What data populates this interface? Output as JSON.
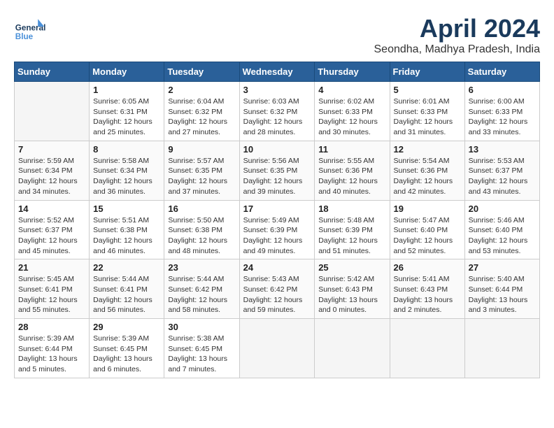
{
  "header": {
    "logo_general": "General",
    "logo_blue": "Blue",
    "title": "April 2024",
    "location": "Seondha, Madhya Pradesh, India"
  },
  "days_of_week": [
    "Sunday",
    "Monday",
    "Tuesday",
    "Wednesday",
    "Thursday",
    "Friday",
    "Saturday"
  ],
  "weeks": [
    [
      {
        "day": "",
        "empty": true
      },
      {
        "day": "1",
        "sunrise": "Sunrise: 6:05 AM",
        "sunset": "Sunset: 6:31 PM",
        "daylight": "Daylight: 12 hours and 25 minutes."
      },
      {
        "day": "2",
        "sunrise": "Sunrise: 6:04 AM",
        "sunset": "Sunset: 6:32 PM",
        "daylight": "Daylight: 12 hours and 27 minutes."
      },
      {
        "day": "3",
        "sunrise": "Sunrise: 6:03 AM",
        "sunset": "Sunset: 6:32 PM",
        "daylight": "Daylight: 12 hours and 28 minutes."
      },
      {
        "day": "4",
        "sunrise": "Sunrise: 6:02 AM",
        "sunset": "Sunset: 6:33 PM",
        "daylight": "Daylight: 12 hours and 30 minutes."
      },
      {
        "day": "5",
        "sunrise": "Sunrise: 6:01 AM",
        "sunset": "Sunset: 6:33 PM",
        "daylight": "Daylight: 12 hours and 31 minutes."
      },
      {
        "day": "6",
        "sunrise": "Sunrise: 6:00 AM",
        "sunset": "Sunset: 6:33 PM",
        "daylight": "Daylight: 12 hours and 33 minutes."
      }
    ],
    [
      {
        "day": "7",
        "sunrise": "Sunrise: 5:59 AM",
        "sunset": "Sunset: 6:34 PM",
        "daylight": "Daylight: 12 hours and 34 minutes."
      },
      {
        "day": "8",
        "sunrise": "Sunrise: 5:58 AM",
        "sunset": "Sunset: 6:34 PM",
        "daylight": "Daylight: 12 hours and 36 minutes."
      },
      {
        "day": "9",
        "sunrise": "Sunrise: 5:57 AM",
        "sunset": "Sunset: 6:35 PM",
        "daylight": "Daylight: 12 hours and 37 minutes."
      },
      {
        "day": "10",
        "sunrise": "Sunrise: 5:56 AM",
        "sunset": "Sunset: 6:35 PM",
        "daylight": "Daylight: 12 hours and 39 minutes."
      },
      {
        "day": "11",
        "sunrise": "Sunrise: 5:55 AM",
        "sunset": "Sunset: 6:36 PM",
        "daylight": "Daylight: 12 hours and 40 minutes."
      },
      {
        "day": "12",
        "sunrise": "Sunrise: 5:54 AM",
        "sunset": "Sunset: 6:36 PM",
        "daylight": "Daylight: 12 hours and 42 minutes."
      },
      {
        "day": "13",
        "sunrise": "Sunrise: 5:53 AM",
        "sunset": "Sunset: 6:37 PM",
        "daylight": "Daylight: 12 hours and 43 minutes."
      }
    ],
    [
      {
        "day": "14",
        "sunrise": "Sunrise: 5:52 AM",
        "sunset": "Sunset: 6:37 PM",
        "daylight": "Daylight: 12 hours and 45 minutes."
      },
      {
        "day": "15",
        "sunrise": "Sunrise: 5:51 AM",
        "sunset": "Sunset: 6:38 PM",
        "daylight": "Daylight: 12 hours and 46 minutes."
      },
      {
        "day": "16",
        "sunrise": "Sunrise: 5:50 AM",
        "sunset": "Sunset: 6:38 PM",
        "daylight": "Daylight: 12 hours and 48 minutes."
      },
      {
        "day": "17",
        "sunrise": "Sunrise: 5:49 AM",
        "sunset": "Sunset: 6:39 PM",
        "daylight": "Daylight: 12 hours and 49 minutes."
      },
      {
        "day": "18",
        "sunrise": "Sunrise: 5:48 AM",
        "sunset": "Sunset: 6:39 PM",
        "daylight": "Daylight: 12 hours and 51 minutes."
      },
      {
        "day": "19",
        "sunrise": "Sunrise: 5:47 AM",
        "sunset": "Sunset: 6:40 PM",
        "daylight": "Daylight: 12 hours and 52 minutes."
      },
      {
        "day": "20",
        "sunrise": "Sunrise: 5:46 AM",
        "sunset": "Sunset: 6:40 PM",
        "daylight": "Daylight: 12 hours and 53 minutes."
      }
    ],
    [
      {
        "day": "21",
        "sunrise": "Sunrise: 5:45 AM",
        "sunset": "Sunset: 6:41 PM",
        "daylight": "Daylight: 12 hours and 55 minutes."
      },
      {
        "day": "22",
        "sunrise": "Sunrise: 5:44 AM",
        "sunset": "Sunset: 6:41 PM",
        "daylight": "Daylight: 12 hours and 56 minutes."
      },
      {
        "day": "23",
        "sunrise": "Sunrise: 5:44 AM",
        "sunset": "Sunset: 6:42 PM",
        "daylight": "Daylight: 12 hours and 58 minutes."
      },
      {
        "day": "24",
        "sunrise": "Sunrise: 5:43 AM",
        "sunset": "Sunset: 6:42 PM",
        "daylight": "Daylight: 12 hours and 59 minutes."
      },
      {
        "day": "25",
        "sunrise": "Sunrise: 5:42 AM",
        "sunset": "Sunset: 6:43 PM",
        "daylight": "Daylight: 13 hours and 0 minutes."
      },
      {
        "day": "26",
        "sunrise": "Sunrise: 5:41 AM",
        "sunset": "Sunset: 6:43 PM",
        "daylight": "Daylight: 13 hours and 2 minutes."
      },
      {
        "day": "27",
        "sunrise": "Sunrise: 5:40 AM",
        "sunset": "Sunset: 6:44 PM",
        "daylight": "Daylight: 13 hours and 3 minutes."
      }
    ],
    [
      {
        "day": "28",
        "sunrise": "Sunrise: 5:39 AM",
        "sunset": "Sunset: 6:44 PM",
        "daylight": "Daylight: 13 hours and 5 minutes."
      },
      {
        "day": "29",
        "sunrise": "Sunrise: 5:39 AM",
        "sunset": "Sunset: 6:45 PM",
        "daylight": "Daylight: 13 hours and 6 minutes."
      },
      {
        "day": "30",
        "sunrise": "Sunrise: 5:38 AM",
        "sunset": "Sunset: 6:45 PM",
        "daylight": "Daylight: 13 hours and 7 minutes."
      },
      {
        "day": "",
        "empty": true
      },
      {
        "day": "",
        "empty": true
      },
      {
        "day": "",
        "empty": true
      },
      {
        "day": "",
        "empty": true
      }
    ]
  ]
}
